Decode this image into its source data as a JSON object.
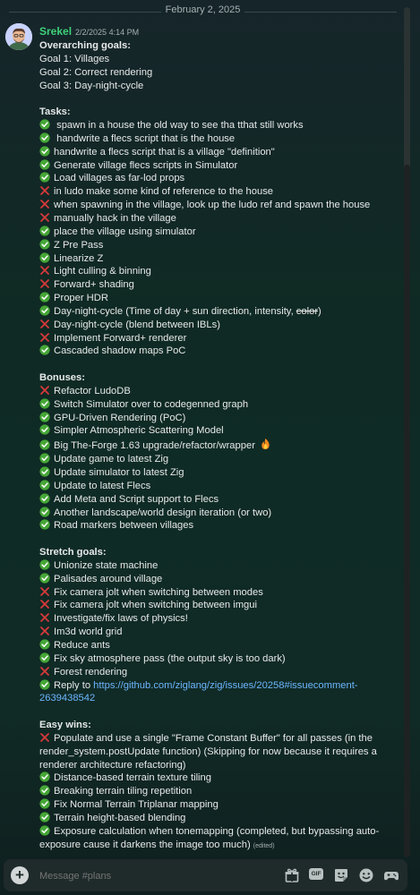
{
  "date_divider": "February 2, 2025",
  "message": {
    "author": "Srekel",
    "timestamp": "2/2/2025 4:14 PM",
    "edited_label": "(edited)",
    "lines": [
      {
        "kind": "bold",
        "text": "Overarching goals:"
      },
      {
        "kind": "text",
        "text": "Goal 1: Villages"
      },
      {
        "kind": "text",
        "text": "Goal 2: Correct rendering"
      },
      {
        "kind": "text",
        "text": "Goal 3: Day-night-cycle"
      },
      {
        "kind": "blank"
      },
      {
        "kind": "bold",
        "text": "Tasks:"
      },
      {
        "kind": "task",
        "status": "check",
        "text": " spawn in a house the old way to see tha tthat still works"
      },
      {
        "kind": "task",
        "status": "check",
        "text": " handwrite a flecs script that is the house"
      },
      {
        "kind": "task",
        "status": "check",
        "text": "handwrite a flecs script that is a village \"definition\""
      },
      {
        "kind": "task",
        "status": "check",
        "text": "Generate village flecs scripts in Simulator"
      },
      {
        "kind": "task",
        "status": "check",
        "text": "Load villages as far-lod props"
      },
      {
        "kind": "task",
        "status": "cross",
        "text": "in ludo make some kind of reference to the house"
      },
      {
        "kind": "task",
        "status": "cross",
        "text": "when spawning in the village, look up the ludo ref and spawn the house"
      },
      {
        "kind": "task",
        "status": "cross",
        "text": "manually hack in the village"
      },
      {
        "kind": "task",
        "status": "check",
        "text": "place the village using simulator"
      },
      {
        "kind": "task",
        "status": "check",
        "text": "Z Pre Pass"
      },
      {
        "kind": "task",
        "status": "check",
        "text": "Linearize Z"
      },
      {
        "kind": "task",
        "status": "cross",
        "text": "Light culling & binning"
      },
      {
        "kind": "task",
        "status": "cross",
        "text": "Forward+ shading"
      },
      {
        "kind": "task",
        "status": "check",
        "text": "Proper HDR"
      },
      {
        "kind": "task",
        "status": "check",
        "text": "Day-night-cycle (Time of day + sun direction, intensity, ",
        "strike": "color",
        "suffix": ")"
      },
      {
        "kind": "task",
        "status": "cross",
        "text": "Day-night-cycle (blend between IBLs)"
      },
      {
        "kind": "task",
        "status": "cross",
        "text": "Implement Forward+ renderer"
      },
      {
        "kind": "task",
        "status": "check",
        "text": "Cascaded shadow maps PoC"
      },
      {
        "kind": "blank"
      },
      {
        "kind": "bold",
        "text": "Bonuses:"
      },
      {
        "kind": "task",
        "status": "cross",
        "text": "Refactor LudoDB"
      },
      {
        "kind": "task",
        "status": "check",
        "text": "Switch Simulator over to codegenned graph"
      },
      {
        "kind": "task",
        "status": "check",
        "text": "GPU-Driven Rendering (PoC)"
      },
      {
        "kind": "task",
        "status": "check",
        "text": "Simpler Atmospheric Scattering Model"
      },
      {
        "kind": "task",
        "status": "check",
        "text": "Big The-Forge 1.63 upgrade/refactor/wrapper ",
        "emoji": "fire"
      },
      {
        "kind": "task",
        "status": "check",
        "text": "Update game to latest Zig"
      },
      {
        "kind": "task",
        "status": "check",
        "text": "Update simulator to latest Zig"
      },
      {
        "kind": "task",
        "status": "check",
        "text": "Update to latest Flecs"
      },
      {
        "kind": "task",
        "status": "check",
        "text": "Add Meta and Script support to Flecs"
      },
      {
        "kind": "task",
        "status": "check",
        "text": "Another landscape/world design iteration (or two)"
      },
      {
        "kind": "task",
        "status": "check",
        "text": "Road markers between villages"
      },
      {
        "kind": "blank"
      },
      {
        "kind": "bold",
        "text": "Stretch goals:"
      },
      {
        "kind": "task",
        "status": "check",
        "text": "Unionize state machine"
      },
      {
        "kind": "task",
        "status": "check",
        "text": "Palisades around village"
      },
      {
        "kind": "task",
        "status": "cross",
        "text": "Fix camera jolt when switching between modes"
      },
      {
        "kind": "task",
        "status": "cross",
        "text": "Fix camera jolt when switching between imgui"
      },
      {
        "kind": "task",
        "status": "cross",
        "text": "Investigate/fix laws of physics!"
      },
      {
        "kind": "task",
        "status": "cross",
        "text": "Im3d world grid"
      },
      {
        "kind": "task",
        "status": "check",
        "text": "Reduce ants"
      },
      {
        "kind": "task",
        "status": "check",
        "text": "Fix sky atmosphere pass (the output sky is too dark)"
      },
      {
        "kind": "task",
        "status": "cross",
        "text": "Forest rendering"
      },
      {
        "kind": "task",
        "status": "check",
        "text": "Reply to ",
        "link": "https://github.com/ziglang/zig/issues/20258#issuecomment-"
      },
      {
        "kind": "link",
        "text": "2639438542"
      },
      {
        "kind": "blank"
      },
      {
        "kind": "bold",
        "text": "Easy wins:"
      },
      {
        "kind": "task",
        "status": "cross",
        "text": "Populate and use a single \"Frame Constant Buffer\" for all passes (in the"
      },
      {
        "kind": "text",
        "text": "render_system.postUpdate function) (Skipping for now because it requires a"
      },
      {
        "kind": "text",
        "text": "renderer architecture refactoring)"
      },
      {
        "kind": "task",
        "status": "check",
        "text": "Distance-based terrain texture tiling"
      },
      {
        "kind": "task",
        "status": "check",
        "text": "Breaking terrain tiling repetition"
      },
      {
        "kind": "task",
        "status": "check",
        "text": "Fix Normal Terrain Triplanar mapping"
      },
      {
        "kind": "task",
        "status": "check",
        "text": "Terrain height-based blending"
      },
      {
        "kind": "task",
        "status": "check",
        "text": "Exposure calculation when tonemapping (completed, but bypassing auto-"
      },
      {
        "kind": "text",
        "text": "exposure cause it darkens the image too much) ",
        "edited": true
      }
    ]
  },
  "composer": {
    "placeholder": "Message #plans",
    "buttons": [
      {
        "name": "gift-icon"
      },
      {
        "name": "gif-icon",
        "label": "GIF"
      },
      {
        "name": "sticker-icon"
      },
      {
        "name": "emoji-icon"
      },
      {
        "name": "apps-icon"
      }
    ]
  },
  "colors": {
    "check": "#45a636",
    "cross": "#d63a3a",
    "author": "#3ed17a",
    "link": "#6cb6ff"
  }
}
